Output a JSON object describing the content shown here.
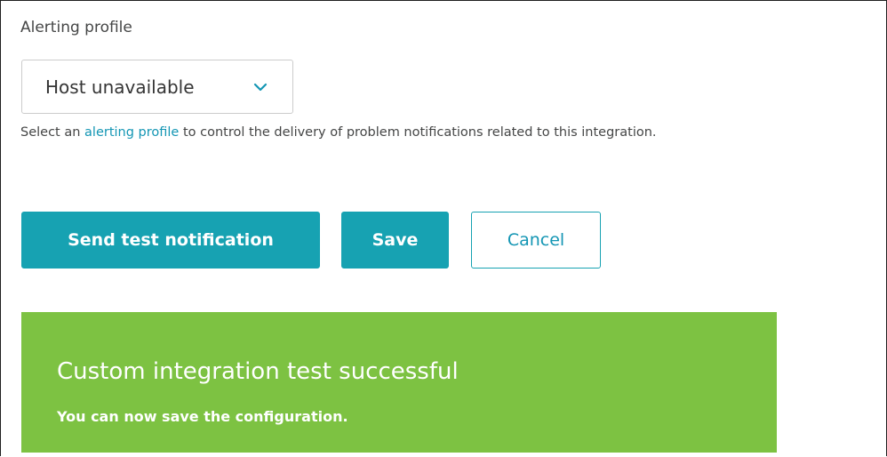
{
  "alerting_profile": {
    "label": "Alerting profile",
    "selected": "Host unavailable",
    "chevron_icon": "chevron-down-icon",
    "help_prefix": "Select an ",
    "help_link": "alerting profile",
    "help_suffix": " to control the delivery of problem notifications related to this integration."
  },
  "actions": {
    "test_label": "Send test notification",
    "save_label": "Save",
    "cancel_label": "Cancel"
  },
  "banner": {
    "title": "Custom integration test successful",
    "message": "You can now save the configuration."
  },
  "colors": {
    "accent": "#17a2b2",
    "link": "#1496b4",
    "success": "#7dc242",
    "text": "#454646"
  }
}
